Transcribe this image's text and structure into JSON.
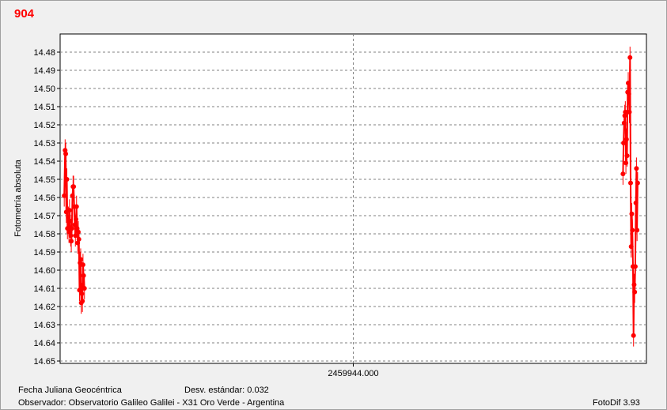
{
  "title": "904",
  "footer": {
    "xlabel": "Fecha Juliana Geocéntrica",
    "std_label": "Desv. estándar: 0.032",
    "observer": "Observador: Observatorio Galileo Galilei - X31 Oro Verde - Argentina",
    "software": "FotoDif 3.93"
  },
  "colors": {
    "series": "#ff0000",
    "background": "#ffffff",
    "grid": "#808080"
  },
  "chart_data": {
    "type": "scatter",
    "title": "904",
    "xlabel": "Fecha Juliana Geocéntrica",
    "ylabel": "Fotometría absoluta",
    "y_inverted": true,
    "ylim": [
      14.48,
      14.65
    ],
    "yticks": [
      "14.48",
      "14.49",
      "14.50",
      "14.51",
      "14.52",
      "14.53",
      "14.54",
      "14.55",
      "14.56",
      "14.57",
      "14.58",
      "14.59",
      "14.60",
      "14.61",
      "14.62",
      "14.63",
      "14.64",
      "14.65"
    ],
    "xtick_label": "2459944.000",
    "x_axis_relative_range": [
      -1,
      1
    ],
    "grid": true,
    "error_bar": 0.006,
    "series": [
      {
        "points": [
          {
            "x": -0.986,
            "y": 14.559
          },
          {
            "x": -0.983,
            "y": 14.534
          },
          {
            "x": -0.981,
            "y": 14.536
          },
          {
            "x": -0.979,
            "y": 14.568
          },
          {
            "x": -0.977,
            "y": 14.55
          },
          {
            "x": -0.975,
            "y": 14.577
          },
          {
            "x": -0.972,
            "y": 14.571
          },
          {
            "x": -0.97,
            "y": 14.579
          },
          {
            "x": -0.968,
            "y": 14.567
          },
          {
            "x": -0.966,
            "y": 14.573
          },
          {
            "x": -0.964,
            "y": 14.581
          },
          {
            "x": -0.962,
            "y": 14.584
          },
          {
            "x": -0.96,
            "y": 14.577
          },
          {
            "x": -0.958,
            "y": 14.559
          },
          {
            "x": -0.956,
            "y": 14.554
          },
          {
            "x": -0.954,
            "y": 14.554
          },
          {
            "x": -0.952,
            "y": 14.565
          },
          {
            "x": -0.95,
            "y": 14.575
          },
          {
            "x": -0.948,
            "y": 14.581
          },
          {
            "x": -0.946,
            "y": 14.572
          },
          {
            "x": -0.944,
            "y": 14.565
          },
          {
            "x": -0.942,
            "y": 14.577
          },
          {
            "x": -0.94,
            "y": 14.585
          },
          {
            "x": -0.938,
            "y": 14.579
          },
          {
            "x": -0.936,
            "y": 14.583
          },
          {
            "x": -0.934,
            "y": 14.611
          },
          {
            "x": -0.932,
            "y": 14.596
          },
          {
            "x": -0.93,
            "y": 14.594
          },
          {
            "x": -0.928,
            "y": 14.618
          },
          {
            "x": -0.926,
            "y": 14.613
          },
          {
            "x": -0.924,
            "y": 14.617
          },
          {
            "x": -0.922,
            "y": 14.597
          },
          {
            "x": -0.92,
            "y": 14.603
          },
          {
            "x": -0.917,
            "y": 14.61
          },
          {
            "x": 0.92,
            "y": 14.547
          },
          {
            "x": 0.922,
            "y": 14.53
          },
          {
            "x": 0.924,
            "y": 14.519
          },
          {
            "x": 0.926,
            "y": 14.515
          },
          {
            "x": 0.928,
            "y": 14.513
          },
          {
            "x": 0.93,
            "y": 14.541
          },
          {
            "x": 0.932,
            "y": 14.528
          },
          {
            "x": 0.934,
            "y": 14.537
          },
          {
            "x": 0.936,
            "y": 14.502
          },
          {
            "x": 0.938,
            "y": 14.497
          },
          {
            "x": 0.94,
            "y": 14.503
          },
          {
            "x": 0.942,
            "y": 14.513
          },
          {
            "x": 0.944,
            "y": 14.483
          },
          {
            "x": 0.946,
            "y": 14.552
          },
          {
            "x": 0.948,
            "y": 14.587
          },
          {
            "x": 0.95,
            "y": 14.569
          },
          {
            "x": 0.952,
            "y": 14.578
          },
          {
            "x": 0.954,
            "y": 14.598
          },
          {
            "x": 0.956,
            "y": 14.636
          },
          {
            "x": 0.958,
            "y": 14.608
          },
          {
            "x": 0.96,
            "y": 14.612
          },
          {
            "x": 0.962,
            "y": 14.598
          },
          {
            "x": 0.964,
            "y": 14.563
          },
          {
            "x": 0.966,
            "y": 14.544
          },
          {
            "x": 0.968,
            "y": 14.578
          },
          {
            "x": 0.97,
            "y": 14.552
          }
        ]
      }
    ]
  }
}
